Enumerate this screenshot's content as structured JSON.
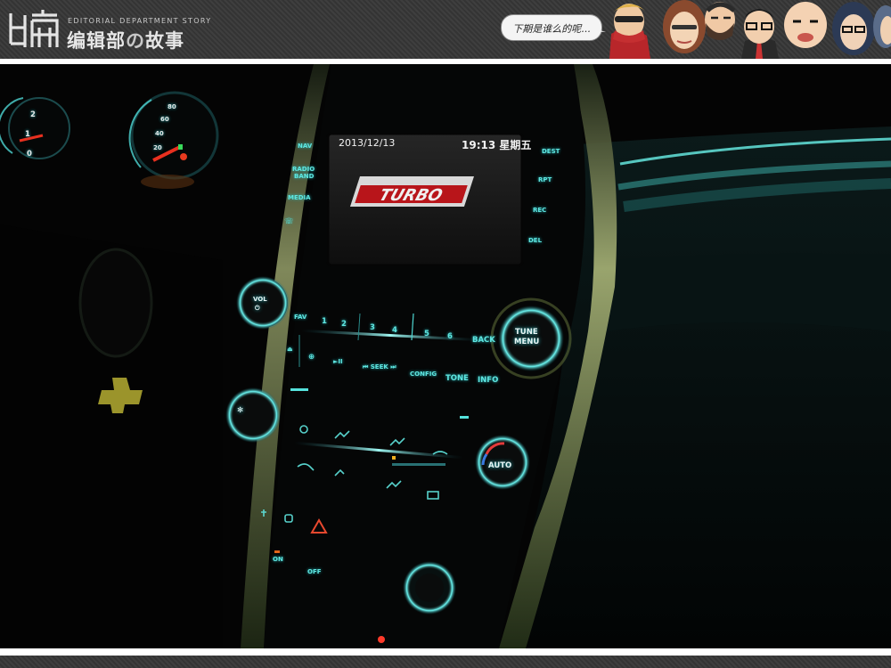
{
  "header": {
    "subtitle": "EDITORIAL DEPARTMENT STORY",
    "title_a": "编辑部",
    "title_no": "の",
    "title_b": "故事",
    "bubble": "下期是谁么的呢..."
  },
  "photo": {
    "screen": {
      "date": "2013/12/13",
      "time": "19:13 星期五",
      "logo": "TURBO"
    },
    "left_buttons": [
      "NAV",
      "RADIO",
      "BAND",
      "MEDIA"
    ],
    "right_buttons": [
      "DEST",
      "RPT",
      "REC",
      "DEL"
    ],
    "knobs": {
      "vol": "VOL",
      "tune_a": "TUNE",
      "tune_b": "MENU",
      "auto": "AUTO"
    },
    "presets": [
      "FAV",
      "1",
      "2",
      "3",
      "4",
      "5",
      "6",
      "BACK"
    ],
    "media_row": [
      "SEEK",
      "CONFIG",
      "TONE",
      "INFO"
    ],
    "misc": [
      "ON",
      "OFF"
    ],
    "gauge_left": [
      "2",
      "1",
      "0"
    ],
    "gauge_right": [
      "80",
      "60",
      "40",
      "20"
    ]
  },
  "colors": {
    "accent": "#3fd6d6",
    "banner": "#3a3a3a",
    "screen": "#1a1a1a"
  }
}
